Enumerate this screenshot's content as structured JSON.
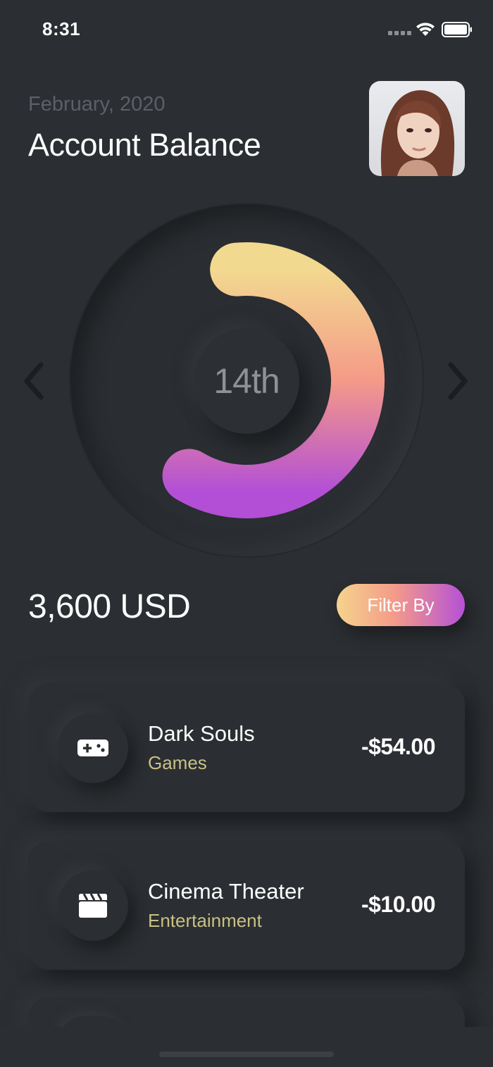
{
  "status_bar": {
    "time": "8:31"
  },
  "header": {
    "date": "February, 2020",
    "title": "Account Balance",
    "avatar_alt": "user-avatar"
  },
  "gauge": {
    "day_label": "14th",
    "progress_fraction": 0.6,
    "gradient_colors": [
      "#f2d990",
      "#f59a88",
      "#b34fd6"
    ]
  },
  "balance": {
    "amount": "3,600 USD"
  },
  "filter": {
    "label": "Filter By"
  },
  "transactions": [
    {
      "name": "Dark Souls",
      "category": "Games",
      "amount": "-$54.00",
      "icon": "gamepad-icon"
    },
    {
      "name": "Cinema Theater",
      "category": "Entertainment",
      "amount": "-$10.00",
      "icon": "clapperboard-icon"
    }
  ],
  "colors": {
    "background": "#2b2e32",
    "category_text": "#c9c084",
    "accent_start": "#f5d48c",
    "accent_end": "#b451d6"
  }
}
